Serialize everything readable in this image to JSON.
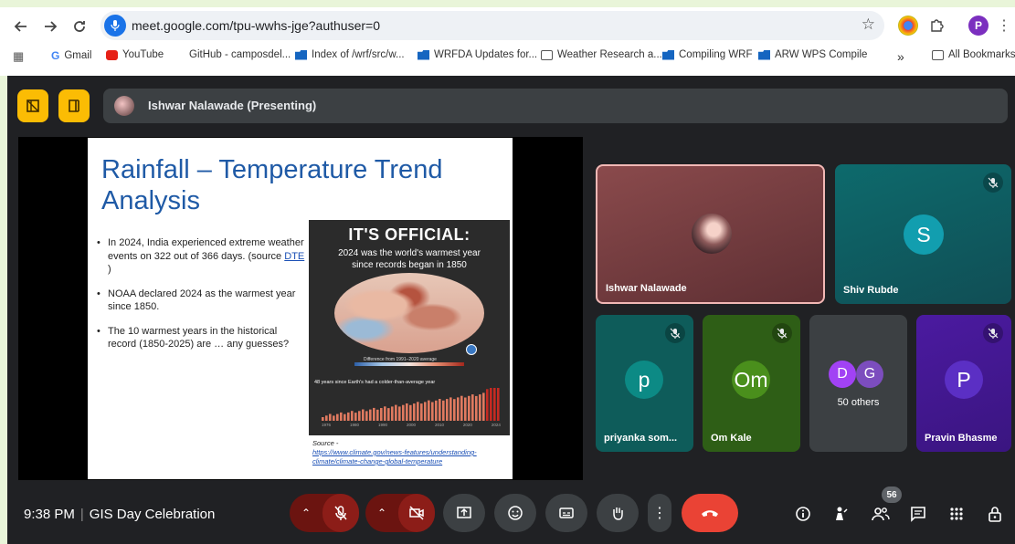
{
  "browser": {
    "url": "meet.google.com/tpu-wwhs-jge?authuser=0",
    "profile_initial": "P",
    "bookmarks": [
      {
        "label": "Gmail",
        "icon": "google-icon"
      },
      {
        "label": "YouTube",
        "icon": "youtube-icon"
      },
      {
        "label": "GitHub - camposdel...",
        "icon": "none"
      },
      {
        "label": "Index of /wrf/src/w...",
        "icon": "folder-icon"
      },
      {
        "label": "WRFDA Updates for...",
        "icon": "folder-icon"
      },
      {
        "label": "Weather Research a...",
        "icon": "page-icon"
      },
      {
        "label": "Compiling WRF",
        "icon": "folder-icon"
      },
      {
        "label": "ARW WPS Compile",
        "icon": "folder-icon"
      }
    ],
    "overflow_label": "»",
    "all_bookmarks_label": "All Bookmarks"
  },
  "meet": {
    "presenter_label": "Ishwar Nalawade (Presenting)",
    "slide": {
      "title": "Rainfall – Temperature Trend Analysis",
      "bullet1_text": "In 2024, India experienced extreme weather events on 322 out of 366 days. (source ",
      "bullet1_link": "DTE",
      "bullet1_end": " )",
      "bullet2": "NOAA declared 2024 as the warmest year since 1850.",
      "bullet3": "The 10 warmest years in the historical record (1850-2025) are … any guesses?",
      "poster_h1": "IT'S OFFICIAL:",
      "poster_h2": "2024 was the world's warmest year since records began in 1850",
      "poster_scale_label": "Difference from 1991–2020 average",
      "poster_bars_label": "48 years since Earth's had a colder-than-average year",
      "poster_axis": [
        "1976",
        "1980",
        "1990",
        "2000",
        "2010",
        "2020",
        "2024"
      ],
      "source_label": "Source -",
      "source_url": "https://www.climate.gov/news-features/understanding-climate/climate-change-global-temperature"
    },
    "participants": [
      {
        "name": "Ishwar Nalawade",
        "avatar": "photo"
      },
      {
        "name": "Shiv Rubde",
        "initial": "S",
        "muted": true
      },
      {
        "name": "priyanka som...",
        "initial": "p",
        "muted": true
      },
      {
        "name": "Om Kale",
        "initial": "Om",
        "muted": true
      },
      {
        "others_initials": [
          "D",
          "G"
        ],
        "others_label": "50 others"
      },
      {
        "name": "Pravin Bhasme",
        "initial": "P",
        "muted": true
      }
    ],
    "time": "9:38 PM",
    "meeting_title": "GIS Day Celebration",
    "people_count": "56",
    "colors": {
      "accent_yellow": "#fbbc04",
      "end_call_red": "#ea4335",
      "muted_red": "#8c1d18",
      "active_speaker_border": "#f2b8b5"
    }
  }
}
